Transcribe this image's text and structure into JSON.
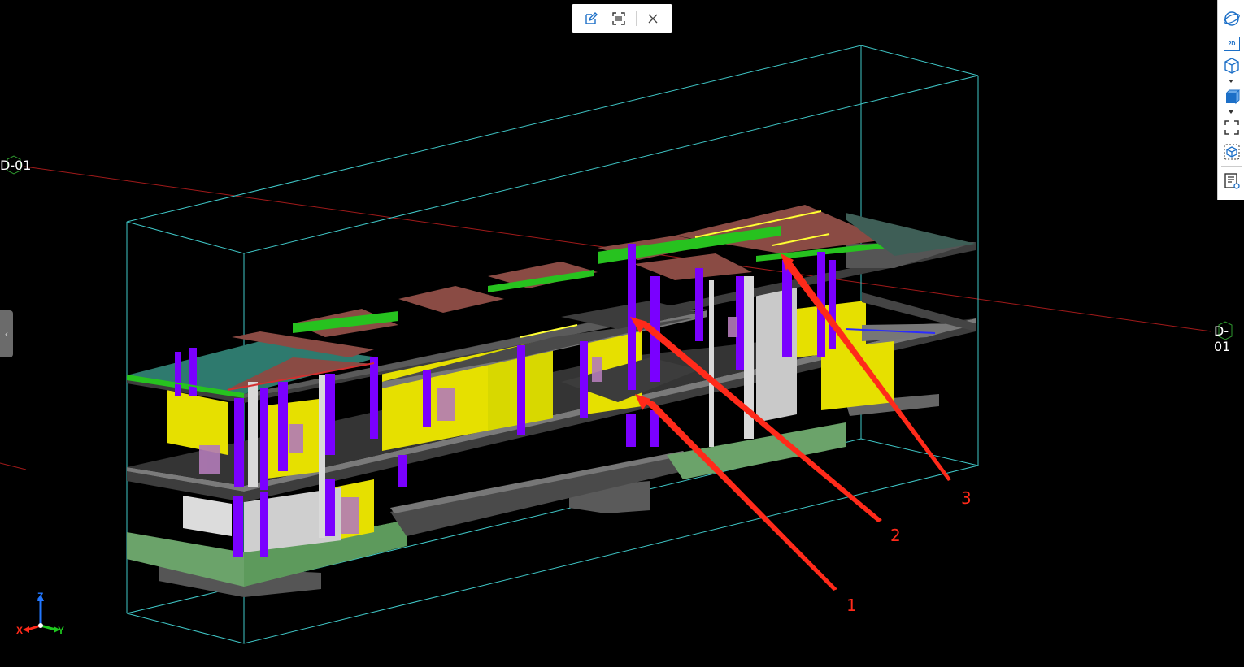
{
  "grid": {
    "label_left": "D-01",
    "label_right": "D-01"
  },
  "annotations": {
    "a1": "1",
    "a2": "2",
    "a3": "3"
  },
  "axes": {
    "z": "Z",
    "x": "X",
    "y": "Y"
  },
  "top_toolbar": {
    "edit_icon": "edit-icon",
    "scan_icon": "scan-icon",
    "close_icon": "close-icon"
  },
  "right_toolbar": {
    "view_2d_label": "2D",
    "icons": [
      "orbit-icon",
      "view-2d-icon",
      "view-cube-icon",
      "solid-box-icon",
      "fit-screen-icon",
      "isolate-icon",
      "properties-icon"
    ]
  },
  "colors": {
    "background": "#000000",
    "bounding_box": "#3fc7c7",
    "slab": "#545454",
    "wall": "#e6e000",
    "column": "#7a00ff",
    "beam": "#27c21f",
    "roof": "#8a4b44",
    "foundation": "#6ba36a",
    "annotation": "#ff2a1a",
    "grid_line": "#a11a1a"
  }
}
